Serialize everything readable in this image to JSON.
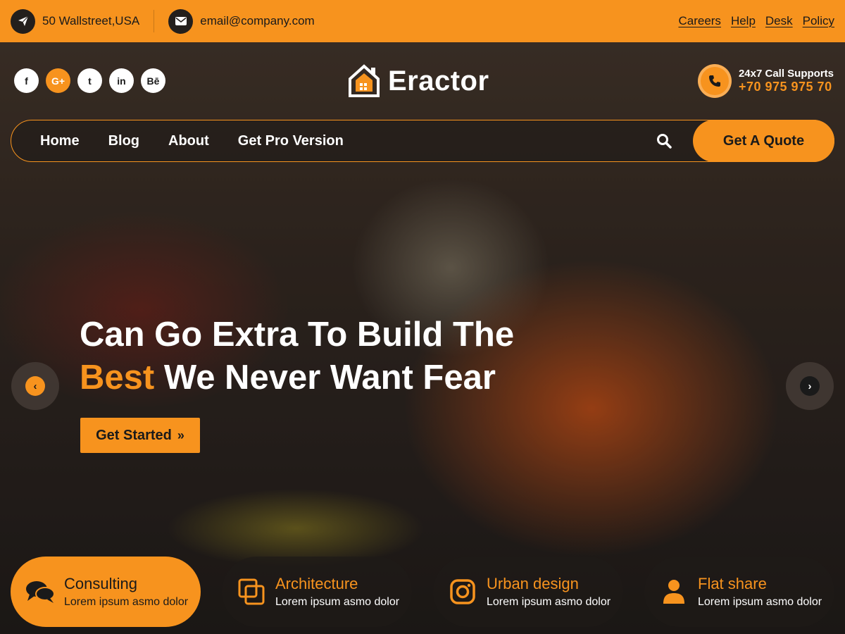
{
  "colors": {
    "accent": "#f7931e",
    "dark": "#231f1c"
  },
  "topbar": {
    "address": "50 Wallstreet,USA",
    "email": "email@company.com",
    "address_icon": "paper-plane-icon",
    "email_icon": "envelope-icon",
    "links": [
      "Careers",
      "Help",
      "Desk",
      "Policy"
    ]
  },
  "social": [
    {
      "icon": "facebook-icon",
      "glyph": "f"
    },
    {
      "icon": "google-plus-icon",
      "glyph": "G+"
    },
    {
      "icon": "twitter-icon",
      "glyph": "t"
    },
    {
      "icon": "linkedin-icon",
      "glyph": "in"
    },
    {
      "icon": "behance-icon",
      "glyph": "Bē"
    }
  ],
  "logo": {
    "text": "Eractor",
    "icon": "house-logo-icon"
  },
  "call": {
    "label": "24x7 Call Supports",
    "number": "+70 975 975 70",
    "icon": "phone-icon"
  },
  "nav": {
    "items": [
      "Home",
      "Blog",
      "About",
      "Get Pro Version"
    ],
    "search_icon": "search-icon",
    "quote_label": "Get A Quote"
  },
  "hero": {
    "line1": "Can Go Extra To Build The",
    "line2_accent": "Best",
    "line2_rest": " We Never Want Fear",
    "cta_label": "Get Started",
    "cta_icon": "»",
    "prev_icon": "‹",
    "next_icon": "›"
  },
  "services": [
    {
      "title": "Consulting",
      "subtitle": "Lorem ipsum asmo dolor",
      "icon": "chat-icon"
    },
    {
      "title": "Architecture",
      "subtitle": "Lorem ipsum asmo dolor",
      "icon": "copy-icon"
    },
    {
      "title": "Urban design",
      "subtitle": "Lorem ipsum asmo dolor",
      "icon": "instagram-icon"
    },
    {
      "title": "Flat share",
      "subtitle": "Lorem ipsum asmo dolor",
      "icon": "user-icon"
    }
  ]
}
